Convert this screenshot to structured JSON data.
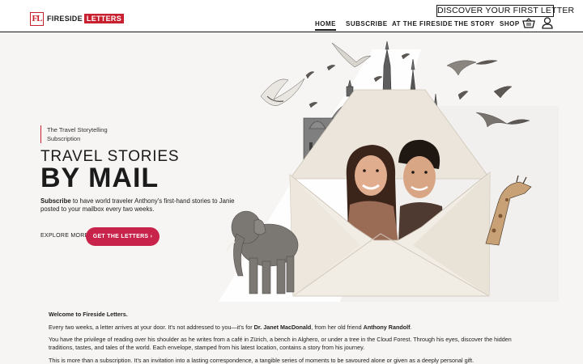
{
  "brand": {
    "mark": "FL",
    "word1": "FIRESIDE",
    "word2": "LETTERS"
  },
  "promo": {
    "label": "DISCOVER YOUR FIRST LETTER"
  },
  "nav": {
    "items": [
      {
        "label": "HOME"
      },
      {
        "label": "SUBSCRIBE"
      },
      {
        "label": "AT THE FIRESIDE"
      },
      {
        "label": "THE STORY"
      },
      {
        "label": "SHOP"
      }
    ],
    "icons": [
      "cart-icon",
      "user-icon"
    ]
  },
  "hero": {
    "eyebrow_line1": "The Travel Storytelling",
    "eyebrow_line2": "Subscription",
    "title_line1": "TRAVEL STORIES",
    "title_line2": "BY MAIL",
    "lead_bold": "Subscribe",
    "lead_rest": " to have world traveler Anthony's first-hand stories to Janie posted to your mailbox every two weeks.",
    "explore_label": "EXPLORE MORE",
    "cta_label": "GET THE LETTERS ›"
  },
  "content": {
    "welcome": "Welcome to Fireside Letters.",
    "p1_a": "Every two weeks, a letter arrives at your door. It's not addressed to you—it's for ",
    "p1_b": "Dr. Janet MacDonald",
    "p1_c": ", from her old friend ",
    "p1_d": "Anthony Randolf",
    "p1_e": ".",
    "p2": "You have the privilege of reading over his shoulder as he writes from a café in Zürich, a bench in Alghero, or under a tree in the Cloud Forest. Through his eyes, discover the hidden traditions, tastes, and tales of the world. Each envelope, stamped from his latest location, contains a story from his journey.",
    "p3": "This is more than a subscription. It's an invitation into a lasting correspondence, a tangible series of moments to be savoured alone or given as a deeply personal gift."
  },
  "colors": {
    "accent": "#c8202f",
    "cta": "#c8234a",
    "background": "#f6f5f3"
  }
}
